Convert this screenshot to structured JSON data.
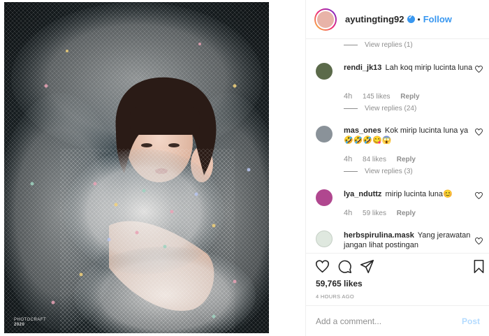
{
  "post": {
    "username": "ayutingting92",
    "follow_label": "Follow",
    "dot": "•",
    "watermark_line1": "PHOTOCRAFT",
    "watermark_year": "2020"
  },
  "comments": [
    {
      "view_replies": "View replies (1)"
    },
    {
      "user": "rendi_jk13",
      "text": "Lah koq mirip lucinta luna",
      "time": "4h",
      "likes": "145 likes",
      "reply": "Reply",
      "view_replies": "View replies (24)",
      "avatar_color": "#5b6a4a"
    },
    {
      "user": "mas_ones",
      "text": "Kok mirip lucinta luna ya🤣🤣🤣😋😱",
      "time": "4h",
      "likes": "84 likes",
      "reply": "Reply",
      "view_replies": "View replies (3)",
      "avatar_color": "#8a9299"
    },
    {
      "user": "lya_nduttz",
      "text": "mirip lucinta luna😊",
      "time": "4h",
      "likes": "59 likes",
      "reply": "Reply",
      "avatar_color": "#b0478f"
    },
    {
      "user": "herbspirulina.mask",
      "text": "Yang jerawatan jangan lihat postingan",
      "avatar_color": "#dfe8df"
    }
  ],
  "actions": {
    "likes": "59,765 likes",
    "time_ago": "4 HOURS AGO"
  },
  "add_comment": {
    "placeholder": "Add a comment...",
    "post_label": "Post"
  },
  "colors": {
    "accent": "#3897f0",
    "muted": "#8e8e8e",
    "text": "#262626"
  },
  "icons": [
    "heart-icon",
    "comment-icon",
    "share-icon",
    "bookmark-icon",
    "verified-badge-icon"
  ]
}
